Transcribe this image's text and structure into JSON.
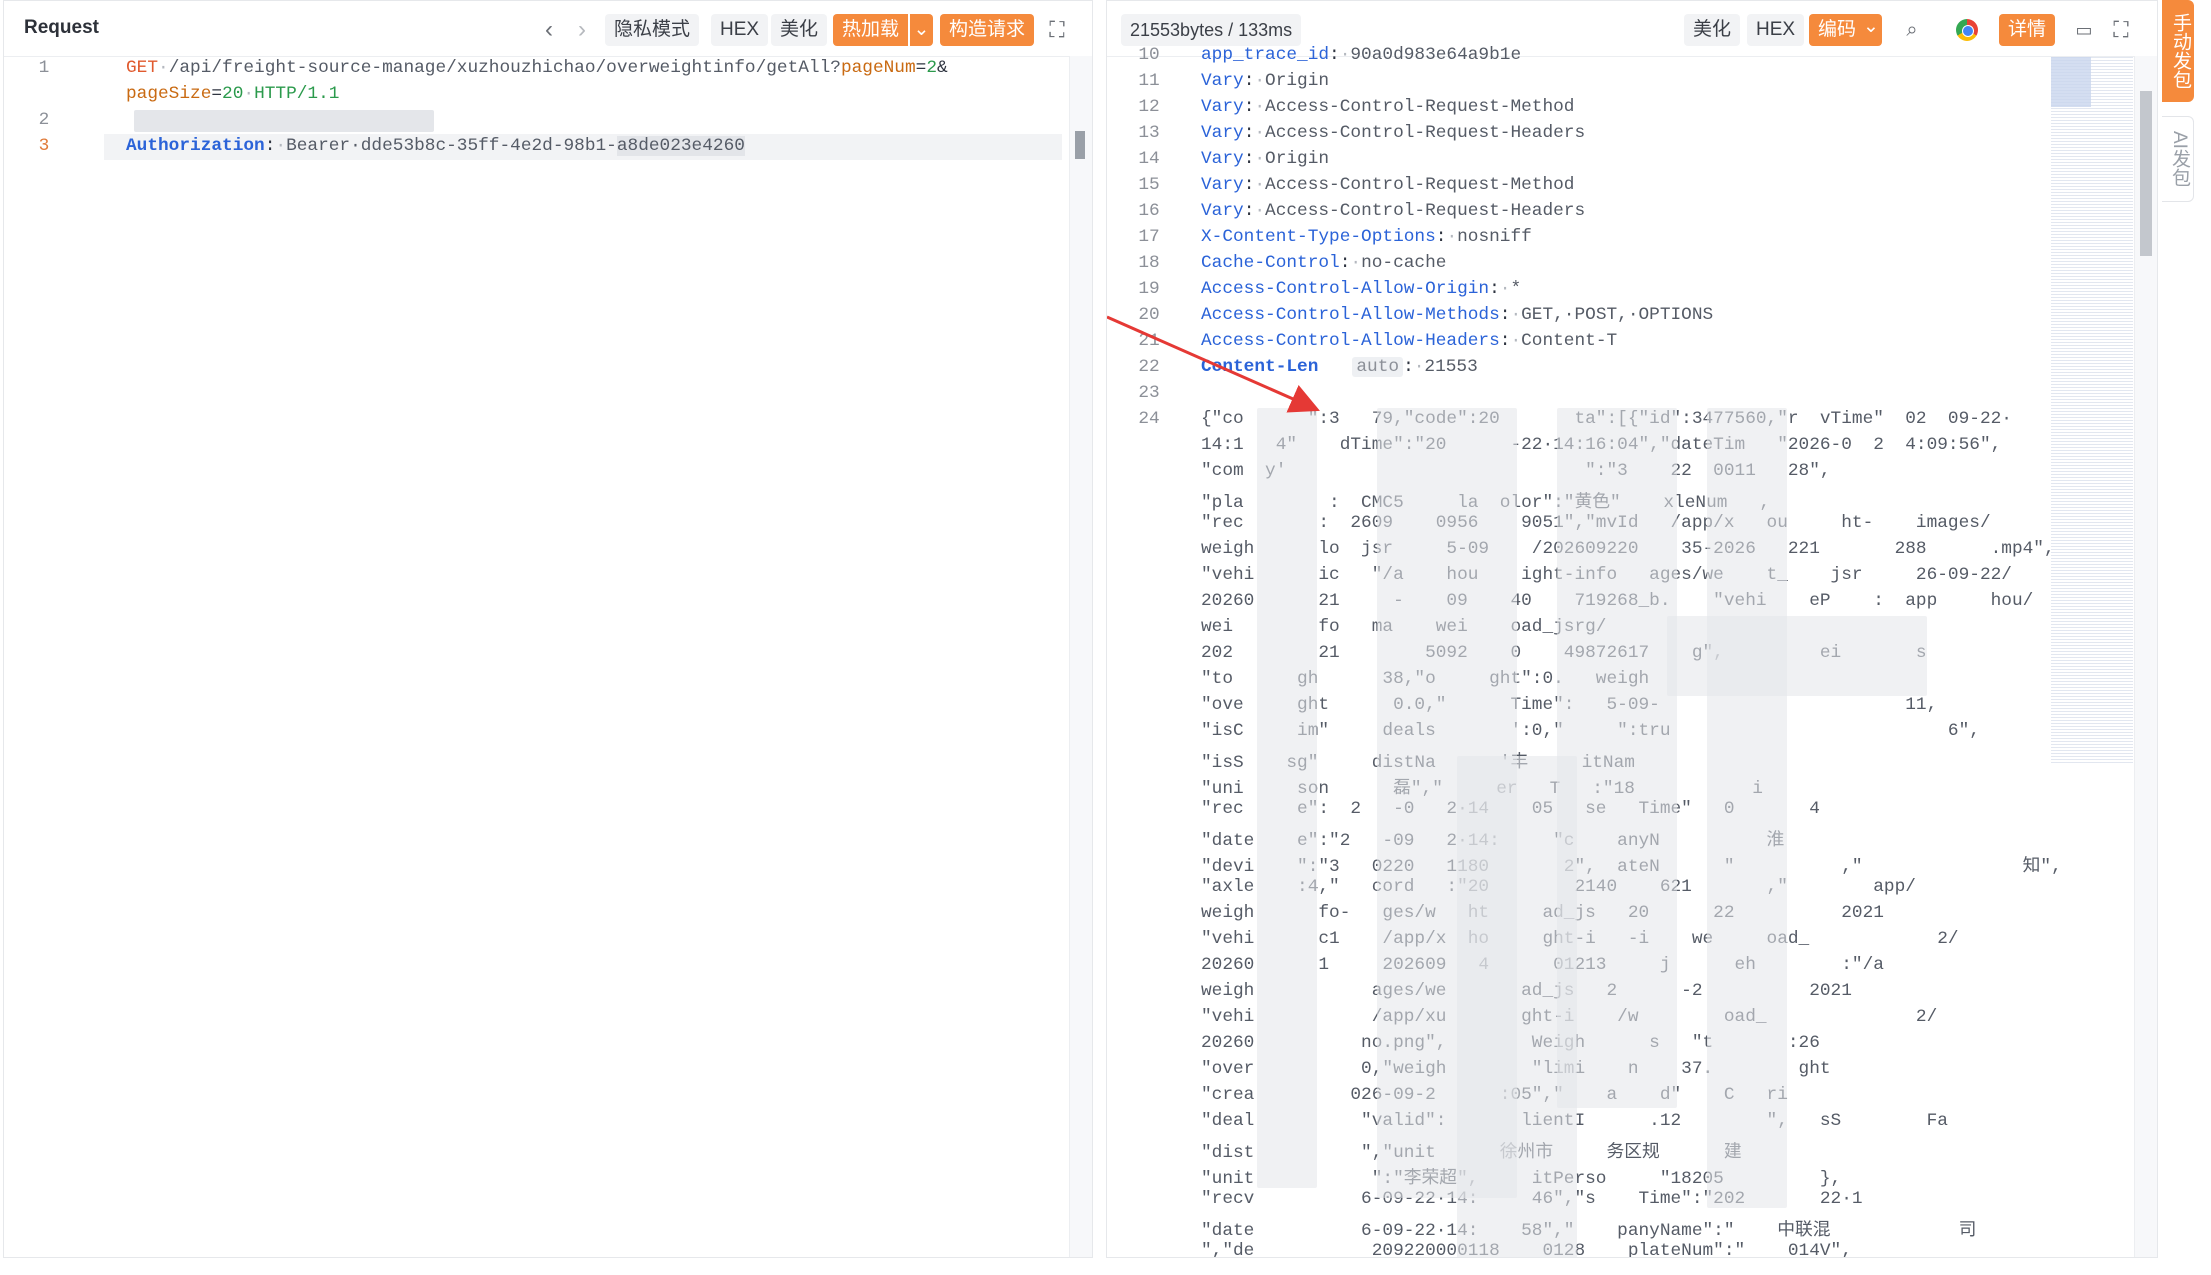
{
  "request": {
    "title": "Request",
    "buttons": {
      "privacy": "隐私模式",
      "hex": "HEX",
      "beautify": "美化",
      "hotload": "热加载",
      "build": "构造请求"
    },
    "lines": {
      "line1_method": "GET",
      "line1_path": "/api/freight-source-manage/xuzhouzhichao/overweightinfo/getAll?",
      "line1_param1": "pageNum",
      "line1_val1": "2",
      "line1b_param2": "pageSize",
      "line1b_val2": "20",
      "line1b_proto": "HTTP/1.1",
      "line3_key": "Authorization",
      "line3_value": "Bearer·dde53b8c-35ff-4e2d-98b1-",
      "line3_selected": "a8de023e4260"
    },
    "line_numbers": [
      "1",
      "2",
      "3"
    ]
  },
  "response": {
    "stats": "21553bytes / 133ms",
    "buttons": {
      "beautify": "美化",
      "hex": "HEX",
      "encoding": "编码",
      "details": "详情"
    },
    "headers": [
      {
        "no": "10",
        "key": "app_trace_id",
        "value": "90a0d983e64a9b1e"
      },
      {
        "no": "11",
        "key": "Vary",
        "value": "Origin"
      },
      {
        "no": "12",
        "key": "Vary",
        "value": "Access-Control-Request-Method"
      },
      {
        "no": "13",
        "key": "Vary",
        "value": "Access-Control-Request-Headers"
      },
      {
        "no": "14",
        "key": "Vary",
        "value": "Origin"
      },
      {
        "no": "15",
        "key": "Vary",
        "value": "Access-Control-Request-Method"
      },
      {
        "no": "16",
        "key": "Vary",
        "value": "Access-Control-Request-Headers"
      },
      {
        "no": "17",
        "key": "X-Content-Type-Options",
        "value": "nosniff"
      },
      {
        "no": "18",
        "key": "Cache-Control",
        "value": "no-cache"
      },
      {
        "no": "19",
        "key": "Access-Control-Allow-Origin",
        "value": "*"
      },
      {
        "no": "20",
        "key": "Access-Control-Allow-Methods",
        "value": "GET,·POST,·OPTIONS"
      },
      {
        "no": "21",
        "key": "Access-Control-Allow-Headers",
        "value": "Content-T"
      }
    ],
    "line22": {
      "no": "22",
      "key": "Content-Len",
      "hint": "auto",
      "value": "21553"
    },
    "line23": "23",
    "line24": "24",
    "body_lines": [
      "{\"co      \":3   79,\"code\":20       ta\":[{\"id\":3477560,\"r  vTime\"  02  09-22·",
      "14:1   4\"    dTime\":\"20      -22·14:16:04\",\"dateTim   \"2026-0  2  4:09:56\",",
      "\"com  y'                            \":\"3    22  0011   28\",",
      "\"pla        :  CMC5     la  olor\":\"黄色\"    xleNum   ,",
      "\"rec       :  2609    0956    9051\",\"mvId   /app/x   ou     ht-    images/",
      "weigh      lo  jsr     5-09    /202609220    35-2026   221       288      .mp4\",",
      "\"vehi      ic   \"/a    hou    ight-info   ages/we    t_    jsr     26-09-22/",
      "20260      21     -    09    40    719268_b.    \"vehi    eP    :  app     hou/",
      "wei        fo   ma    wei    oad_jsrg/",
      "202        21        5092    0    49872617    g\",         ei       s",
      "\"to      gh      38,\"o     ght\":0.   weigh",
      "\"ove     ght      0.0,\"      Time\":   5-09-                       11,",
      "\"isC     im\"     deals       ':0,\"     \":tru                          6\",",
      "\"isS    sg\"     distNa      '丰     itNam",
      "\"uni     son      磊\",\"     er   T   :\"18           i",
      "\"rec     e\":  2   -0   2·14    05   se   Time\"   0       4",
      "\"date    e\":\"2   -09   2·14:     \"c    anyN          淮",
      "\"devi    \":\"3   0220   1180       2\",  ateN      \"          ,\"               知\",",
      "\"axle    :4,\"   cord   :\"20        2140    621       ,\"        app/",
      "weigh      fo-   ges/w   ht     ad_js   20      22          2021",
      "\"vehi      c1    /app/x  ho     ght-i   -i    we     oad_            2/",
      "20260      1     202609   4      01213     j      eh        :\"/a",
      "weigh           ages/we       ad_js   2      -2          2021",
      "\"vehi           /app/xu       ght-i    /w        oad_              2/",
      "20260          no.png\",        Weigh      s   \"t       :26",
      "\"over          0,\"weigh        \"limi    n    37.        ght",
      "\"crea         026-09-2      :05\",\"    a    d\"    C   ri",
      "\"deal          \"valid\":       lientI      .12        \",   sS        Fa",
      "\"dist          \",\"unit      徐州市     务区规      建",
      "\"unit           \":\"李荣超\",     itPerso     \"18205         },",
      "\"recv          6-09-22·14:     46\",\"s    Time\":\"202       22·1",
      "\"date          6-09-22·14:    58\",\"    panyName\":\"    中联混            司",
      "\",\"de           209220000118    0128    plateNum\":\"    014V\","
    ]
  },
  "sidebar": {
    "manual": "手动发包",
    "ai": "AI发包"
  }
}
